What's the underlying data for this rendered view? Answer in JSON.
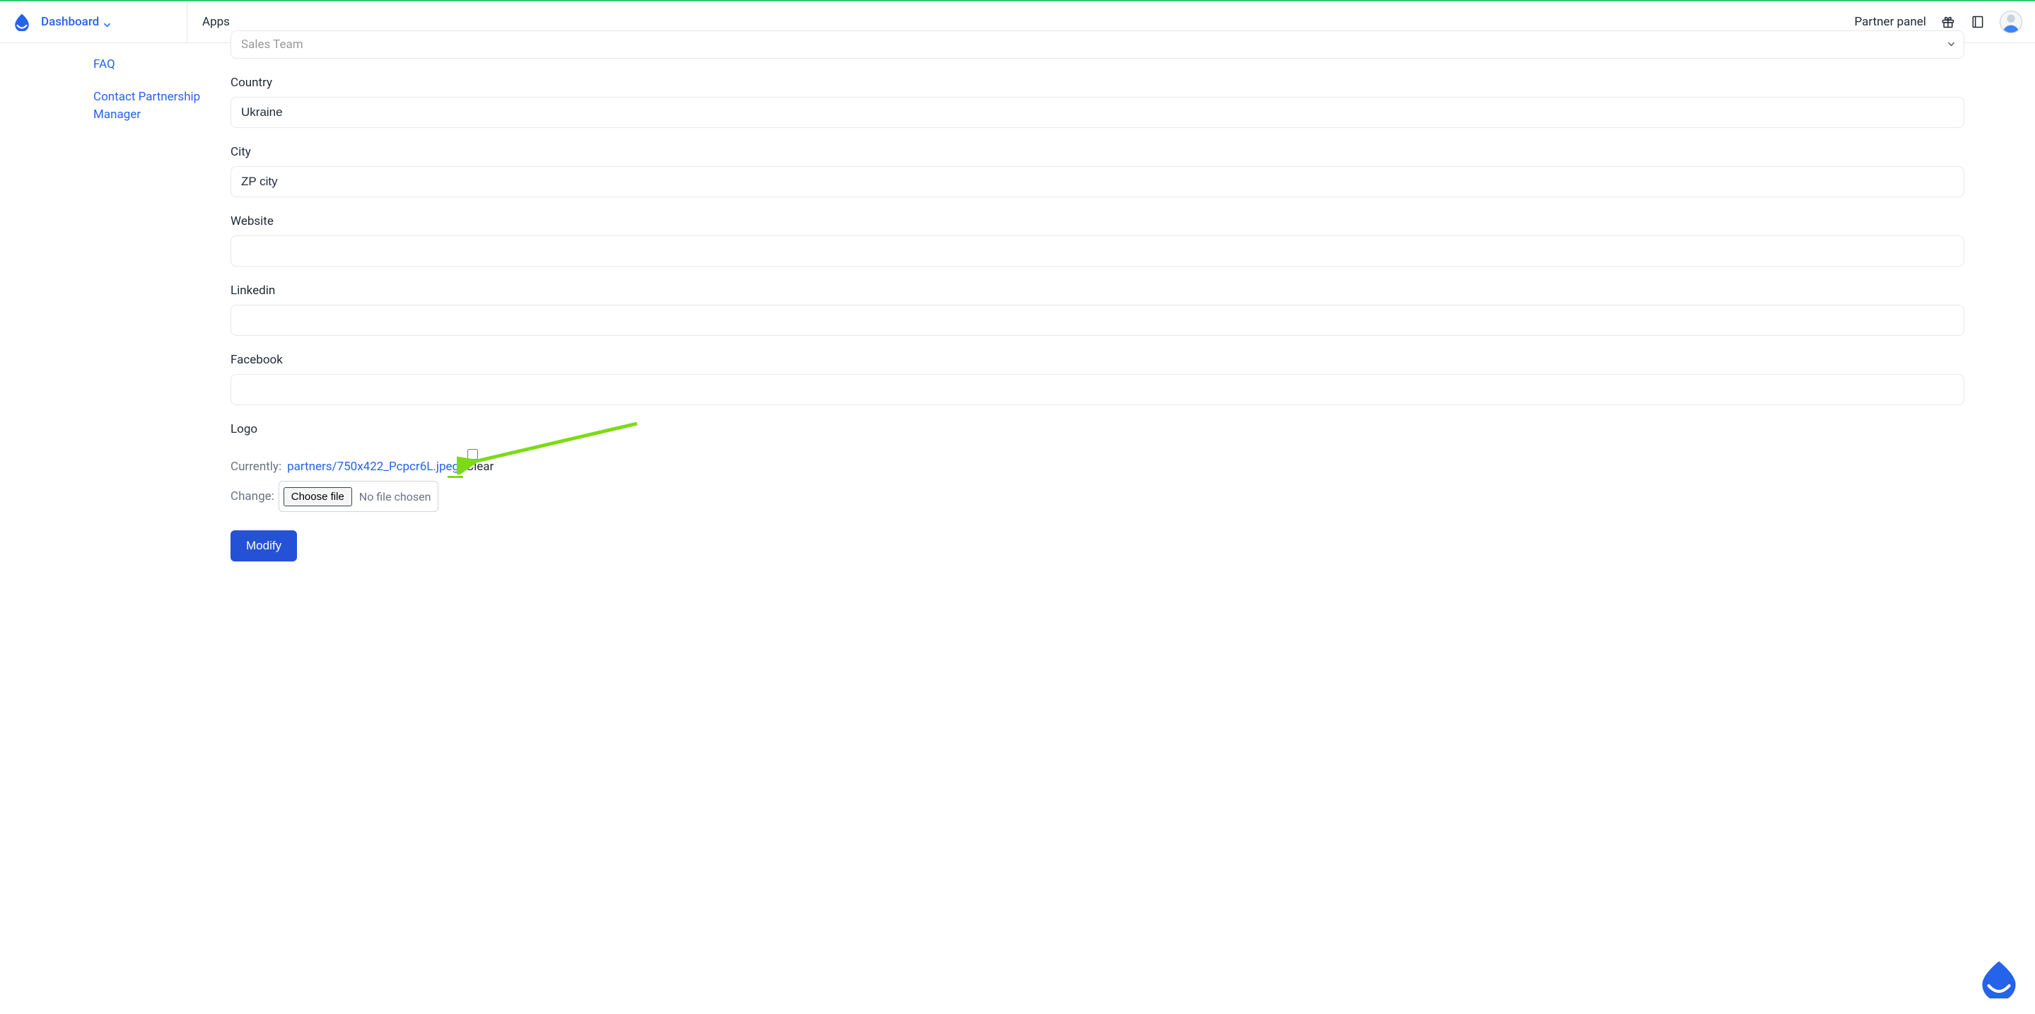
{
  "header": {
    "brand": "Dashboard",
    "apps": "Apps",
    "partner_panel": "Partner panel"
  },
  "sidebar": {
    "items": [
      {
        "key": "faq",
        "label": "FAQ"
      },
      {
        "key": "contact",
        "label": "Contact Partnership Manager"
      }
    ]
  },
  "form": {
    "select_truncated_value": "Sales Team",
    "country_label": "Country",
    "country_value": "Ukraine",
    "city_label": "City",
    "city_value": "ZP city",
    "website_label": "Website",
    "website_value": "",
    "linkedin_label": "Linkedin",
    "linkedin_value": "",
    "facebook_label": "Facebook",
    "facebook_value": "",
    "logo_label": "Logo",
    "currently_prefix": "Currently:",
    "currently_file": "partners/750x422_Pcpcr6L.jpeg",
    "clear_label": "Clear",
    "change_prefix": "Change:",
    "choose_file_label": "Choose file",
    "no_file_label": "No file chosen",
    "submit_label": "Modify"
  }
}
